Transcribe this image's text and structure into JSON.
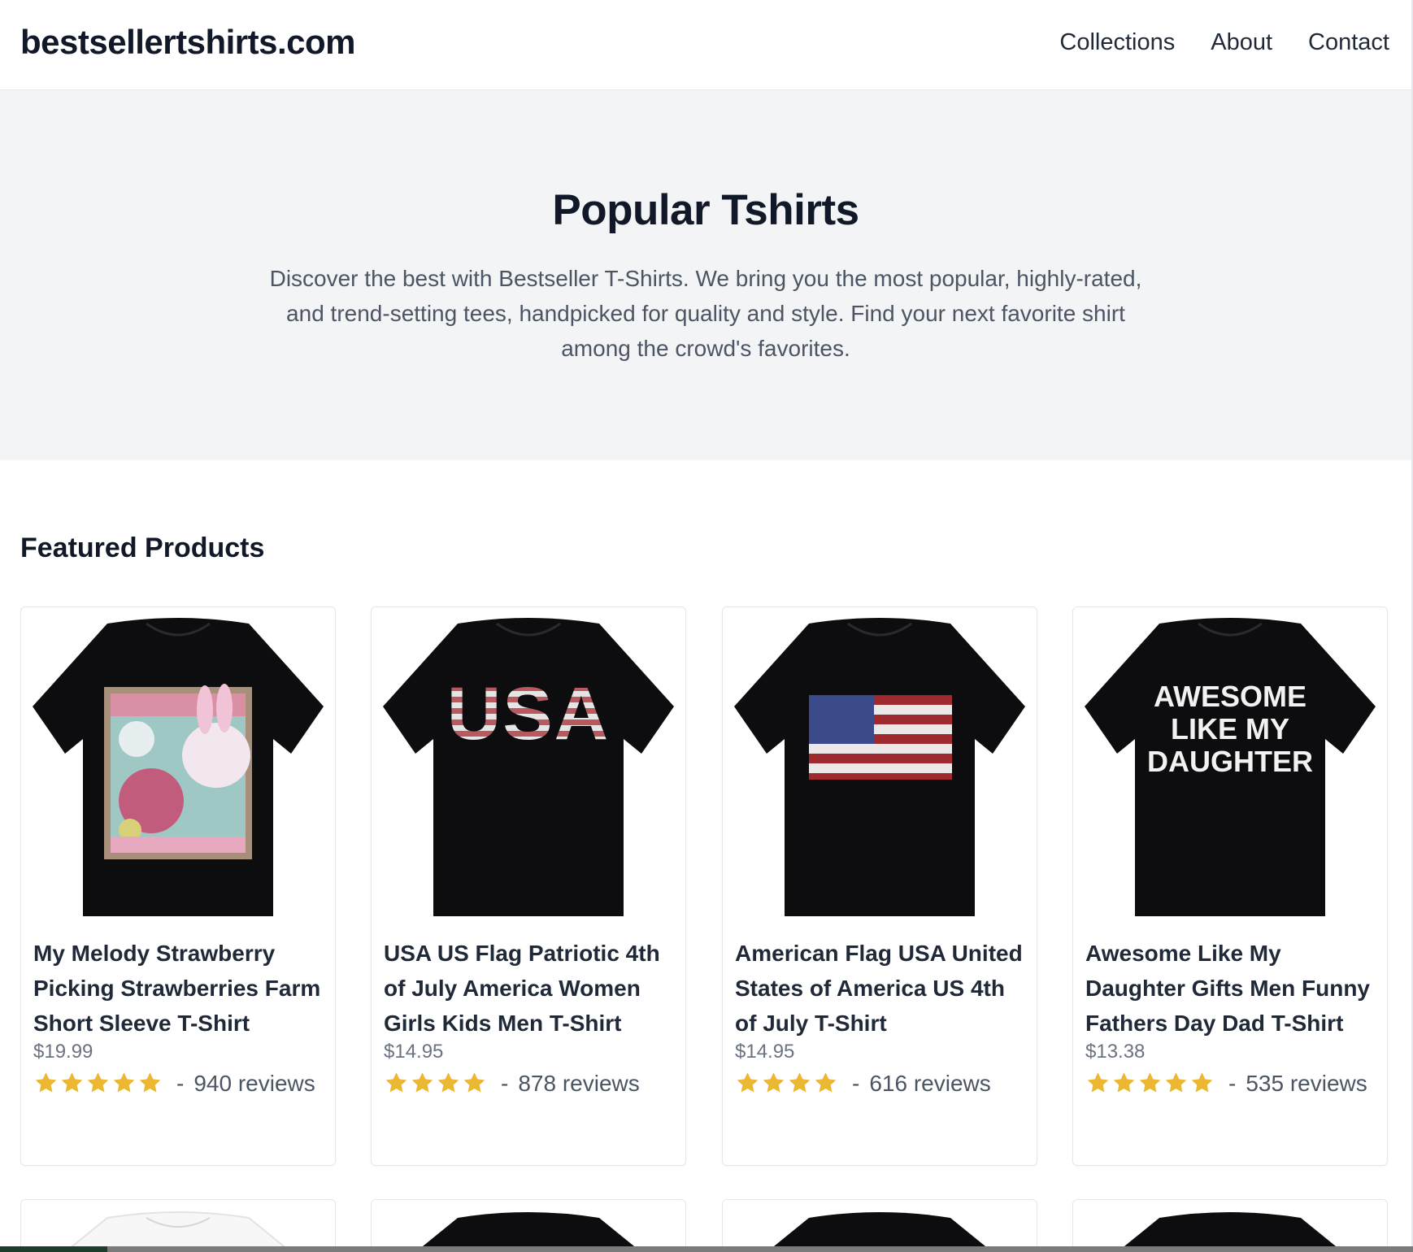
{
  "header": {
    "logo": "bestsellertshirts.com",
    "nav": [
      "Collections",
      "About",
      "Contact"
    ]
  },
  "hero": {
    "title": "Popular Tshirts",
    "description": "Discover the best with Bestseller T-Shirts. We bring you the most popular, highly-rated, and trend-setting tees, handpicked for quality and style. Find your next favorite shirt among the crowd's favorites."
  },
  "featured": {
    "title": "Featured Products",
    "products": [
      {
        "title": "My Melody Strawberry Picking Strawberries Farm Short Sleeve T-Shirt",
        "price": "$19.99",
        "stars": 5,
        "reviews": "940 reviews",
        "design": "cartoon-print"
      },
      {
        "title": "USA US Flag Patriotic 4th of July America Women Girls Kids Men T-Shirt",
        "price": "$14.95",
        "stars": 4,
        "reviews": "878 reviews",
        "design_text": "USA"
      },
      {
        "title": "American Flag USA United States of America US 4th of July T-Shirt",
        "price": "$14.95",
        "stars": 4,
        "reviews": "616 reviews",
        "design": "american-flag"
      },
      {
        "title": "Awesome Like My Daughter Gifts Men Funny Fathers Day Dad T-Shirt",
        "price": "$13.38",
        "stars": 5,
        "reviews": "535 reviews",
        "design_text_lines": [
          "AWESOME",
          "LIKE MY",
          "DAUGHTER"
        ]
      }
    ]
  },
  "colors": {
    "star": "#ecb733",
    "shirt_black": "#0d0d0f",
    "hero_bg": "#f3f4f6"
  }
}
